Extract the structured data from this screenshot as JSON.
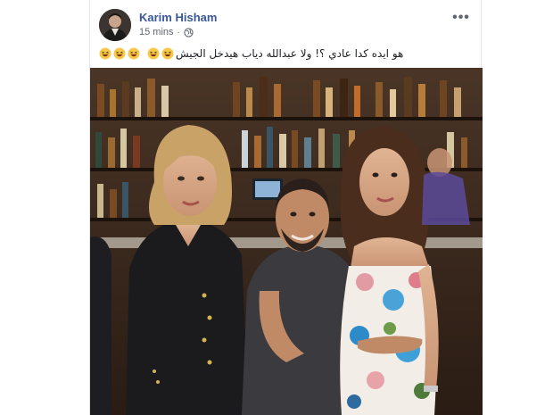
{
  "post": {
    "author": "Karim Hisham",
    "timestamp": "15 mins",
    "separator": "·",
    "privacy_icon": "globe-icon",
    "more_icon": "more-options-icon",
    "more_label": "•••",
    "text": "هو ايده كدا عادي ؟! ولا عبدالله دياب هيدخل الجيش",
    "emojis": [
      "laughing-emoji",
      "laughing-emoji",
      "laughing-emoji",
      "laughing-emoji",
      "laughing-emoji"
    ]
  },
  "colors": {
    "author_link": "#385898",
    "meta_text": "#616770",
    "body_text": "#1c1e21",
    "emoji_face": "#f7c94a"
  }
}
